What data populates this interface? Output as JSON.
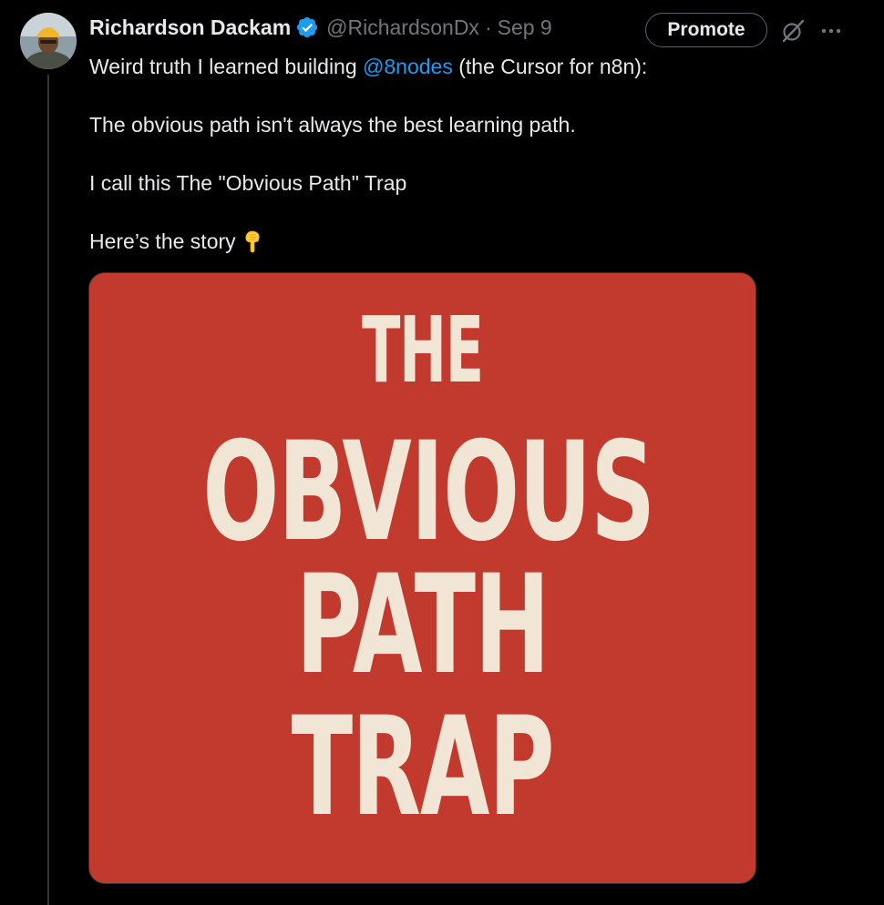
{
  "tweet": {
    "author": {
      "display_name": "Richardson Dackam",
      "handle": "@RichardsonDx",
      "separator": "·",
      "date": "Sep 9",
      "verified": true
    },
    "actions": {
      "promote_label": "Promote",
      "grok_icon": "grok-icon",
      "more_icon": "more-horizontal-icon"
    },
    "text": {
      "line1_before": "Weird truth I learned building ",
      "line1_mention": "@8nodes",
      "line1_after": " (the Cursor for n8n):",
      "line2": "The obvious path isn't always the best learning path.",
      "line3": "I call this The \"Obvious Path\" Trap",
      "line4": "Here’s the story",
      "emoji": "backhand-index-pointing-down"
    },
    "media": {
      "lines": [
        "THE",
        "OBVIOUS",
        "PATH",
        "TRAP"
      ],
      "background_color": "#c23a2e",
      "text_color": "#f1e6d5"
    }
  },
  "colors": {
    "background": "#000000",
    "primary_text": "#e7e9ea",
    "secondary_text": "#71767b",
    "link": "#1d9bf0",
    "verified_badge": "#1d9bf0"
  }
}
